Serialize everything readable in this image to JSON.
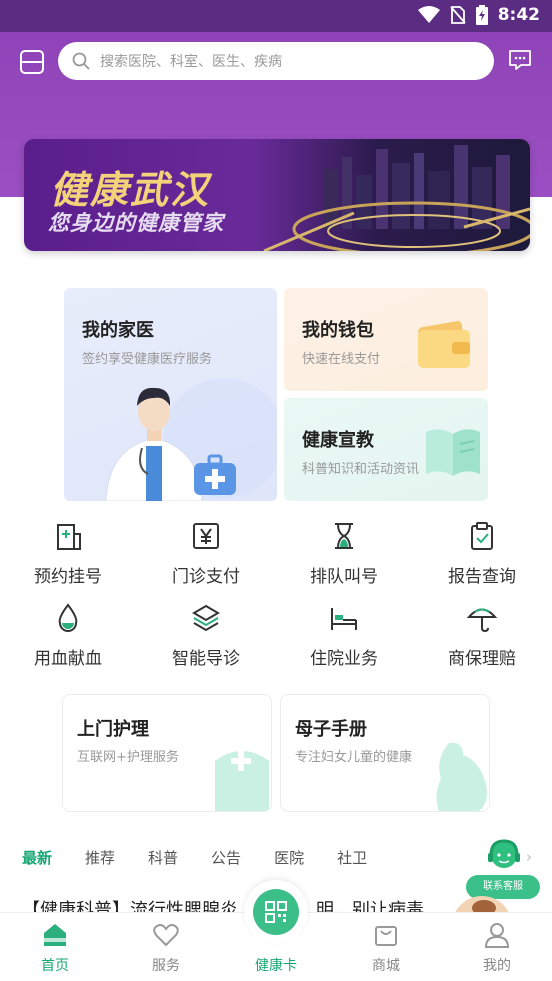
{
  "status_bar": {
    "time": "8:42"
  },
  "header": {
    "search_placeholder": "搜索医院、科室、医生、疾病"
  },
  "banner": {
    "title": "健康武汉",
    "subtitle": "您身边的健康管家"
  },
  "feature_cards": {
    "doctor": {
      "title": "我的家医",
      "subtitle": "签约享受健康医疗服务"
    },
    "wallet": {
      "title": "我的钱包",
      "subtitle": "快速在线支付"
    },
    "education": {
      "title": "健康宣教",
      "subtitle": "科普知识和活动资讯"
    }
  },
  "services": [
    {
      "label": "预约挂号",
      "icon": "hospital-icon"
    },
    {
      "label": "门诊支付",
      "icon": "yuan-icon"
    },
    {
      "label": "排队叫号",
      "icon": "hourglass-icon"
    },
    {
      "label": "报告查询",
      "icon": "clipboard-icon"
    },
    {
      "label": "用血献血",
      "icon": "blood-drop-icon"
    },
    {
      "label": "智能导诊",
      "icon": "layers-icon"
    },
    {
      "label": "住院业务",
      "icon": "bed-icon"
    },
    {
      "label": "商保理赔",
      "icon": "umbrella-icon"
    }
  ],
  "promo_cards": {
    "nursing": {
      "title": "上门护理",
      "subtitle": "互联网+护理服务"
    },
    "maternal": {
      "title": "母子手册",
      "subtitle": "专注妇女儿童的健康"
    }
  },
  "news_tabs": [
    "最新",
    "推荐",
    "科普",
    "公告",
    "医院",
    "社卫"
  ],
  "customer_service": {
    "label": "联系客服"
  },
  "article": {
    "title": "【健康科普】流行性腮腺炎",
    "title_tail": "明，别让病毒"
  },
  "bottom_nav": {
    "home": "首页",
    "services": "服务",
    "health_card": "健康卡",
    "mall": "商城",
    "mine": "我的"
  },
  "colors": {
    "brand_purple": "#8e44b8",
    "accent_green": "#17a774"
  }
}
